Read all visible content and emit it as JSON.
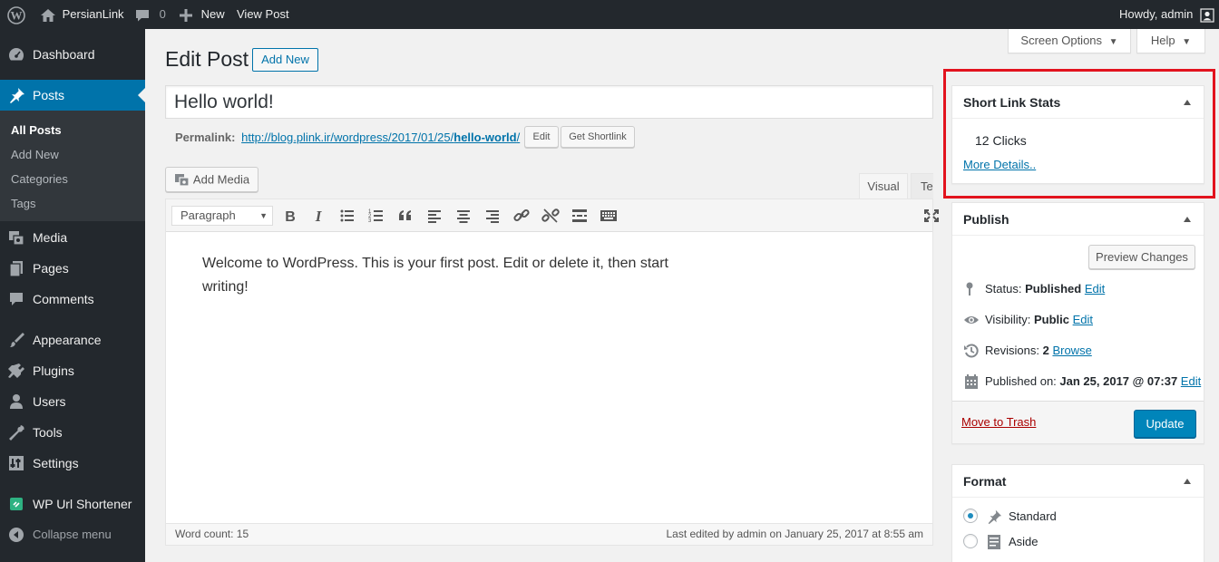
{
  "adminbar": {
    "site_name": "PersianLink",
    "comments_count": "0",
    "new_label": "New",
    "view_post": "View Post",
    "howdy": "Howdy, admin"
  },
  "sidebar": {
    "dashboard": "Dashboard",
    "posts": "Posts",
    "sub": {
      "all_posts": "All Posts",
      "add_new": "Add New",
      "categories": "Categories",
      "tags": "Tags"
    },
    "media": "Media",
    "pages": "Pages",
    "comments": "Comments",
    "appearance": "Appearance",
    "plugins": "Plugins",
    "users": "Users",
    "tools": "Tools",
    "settings": "Settings",
    "shortener": "WP Url Shortener",
    "collapse": "Collapse menu"
  },
  "screen_options": "Screen Options",
  "help": "Help",
  "page": {
    "title": "Edit Post",
    "add_new": "Add New",
    "post_title": "Hello world!",
    "permalink_label": "Permalink:",
    "permalink_base": "http://blog.plink.ir/wordpress/2017/01/25/",
    "permalink_slug": "hello-world",
    "permalink_tail": "/",
    "edit_btn": "Edit",
    "shortlink_btn": "Get Shortlink",
    "add_media": "Add Media"
  },
  "editor": {
    "tab_visual": "Visual",
    "tab_text": "Text",
    "format": "Paragraph",
    "content": "Welcome to WordPress. This is your first post. Edit or delete it, then start writing!",
    "word_count": "Word count: 15",
    "last_edited": "Last edited by admin on January 25, 2017 at 8:55 am"
  },
  "shortlink_box": {
    "title": "Short Link Stats",
    "clicks": "12 Clicks",
    "more": "More Details.."
  },
  "publish": {
    "title": "Publish",
    "preview": "Preview Changes",
    "status_label": "Status:",
    "status_value": "Published",
    "visibility_label": "Visibility:",
    "visibility_value": "Public",
    "revisions_label": "Revisions:",
    "revisions_value": "2",
    "browse": "Browse",
    "published_label": "Published on:",
    "published_value": "Jan 25, 2017 @ 07:37",
    "edit": "Edit",
    "trash": "Move to Trash",
    "update": "Update"
  },
  "format_box": {
    "title": "Format",
    "standard": "Standard",
    "aside": "Aside"
  },
  "colors": {
    "accent": "#0073aa",
    "highlight": "#e2131e",
    "adminbar": "#23282d",
    "trash": "#a00"
  }
}
